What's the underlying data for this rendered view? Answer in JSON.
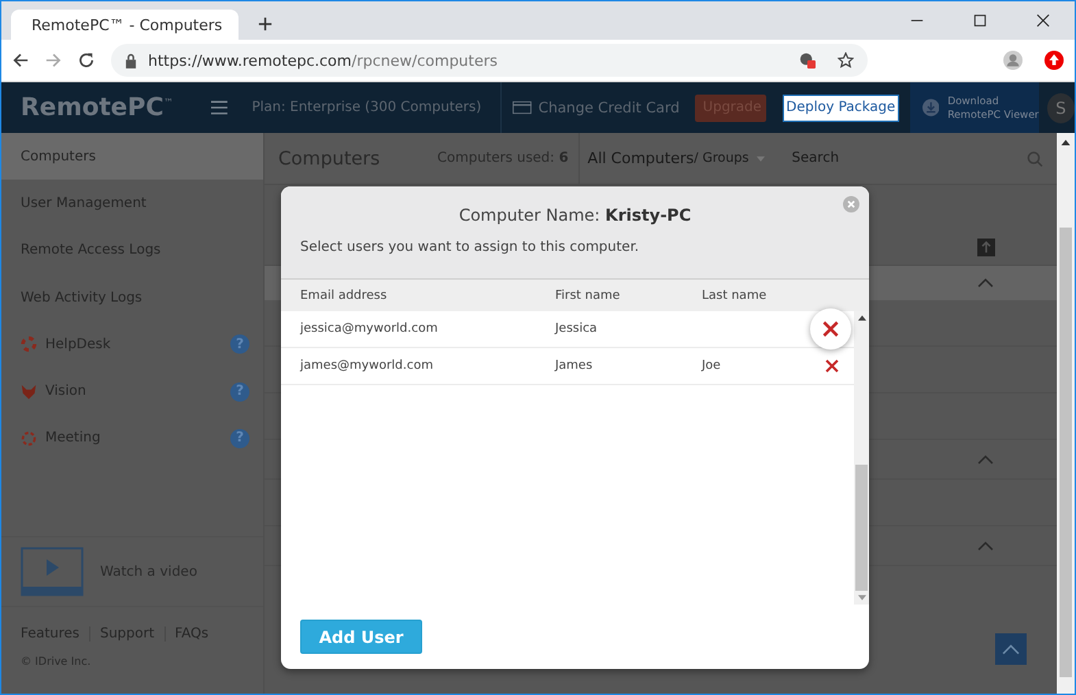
{
  "browser": {
    "tab_title": "RemotePC™ - Computers",
    "url_host": "https://www.remotepc.com",
    "url_path": "/rpcnew/computers"
  },
  "header": {
    "logo": "RemotePC",
    "logo_mark": "™",
    "plan": "Plan: Enterprise (300 Computers)",
    "change_card": "Change Credit Card",
    "upgrade": "Upgrade",
    "deploy": "Deploy Package",
    "download_line1": "Download",
    "download_line2": "RemotePC Viewer",
    "avatar": "S"
  },
  "sidebar": {
    "items": [
      {
        "label": "Computers",
        "selected": true,
        "kind": "plain"
      },
      {
        "label": "User Management",
        "selected": false,
        "kind": "plain"
      },
      {
        "label": "Remote Access Logs",
        "selected": false,
        "kind": "plain"
      },
      {
        "label": "Web Activity Logs",
        "selected": false,
        "kind": "plain"
      },
      {
        "label": "HelpDesk",
        "selected": false,
        "kind": "helpdesk",
        "help": "?"
      },
      {
        "label": "Vision",
        "selected": false,
        "kind": "vision",
        "help": "?"
      },
      {
        "label": "Meeting",
        "selected": false,
        "kind": "meeting",
        "help": "?"
      }
    ],
    "video": "Watch a video",
    "footer_links": [
      "Features",
      "Support",
      "FAQs"
    ],
    "copyright": "© IDrive Inc."
  },
  "main": {
    "title": "Computers",
    "used_label": "Computers used:",
    "used_count": "6",
    "filter_main": "All Computers",
    "filter_sub": " / Groups",
    "search": {
      "placeholder": "Search"
    }
  },
  "modal": {
    "title": "Computer Name:",
    "title_name": "Kristy-PC",
    "subtitle": "Select users you want to assign to this computer.",
    "columns": [
      "Email address",
      "First name",
      "Last name"
    ],
    "rows": [
      {
        "email": "jessica@myworld.com",
        "first": "Jessica",
        "last": "",
        "highlighted": true
      },
      {
        "email": "james@myworld.com",
        "first": "James",
        "last": "Joe",
        "highlighted": false
      }
    ],
    "add_button": "Add User"
  }
}
